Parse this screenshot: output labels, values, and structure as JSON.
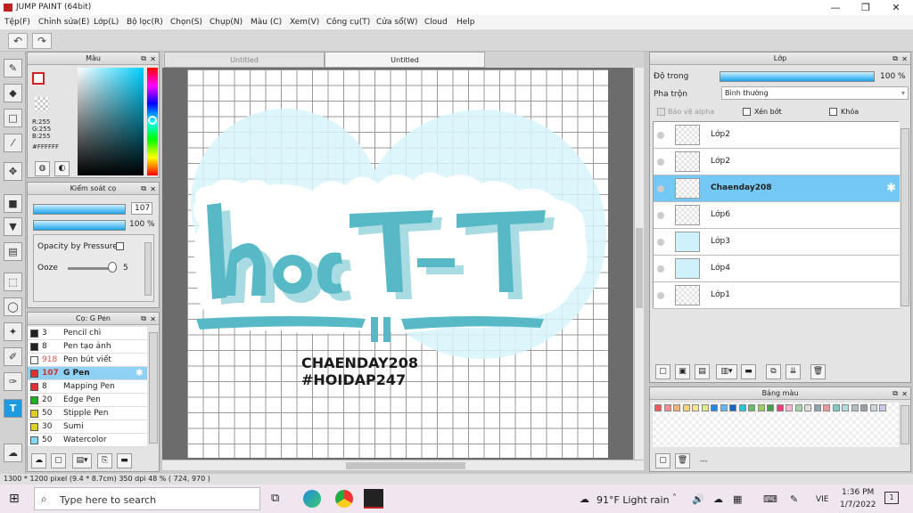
{
  "window": {
    "title": "JUMP PAINT (64bit)"
  },
  "menu": [
    "Tệp(F)",
    "Chỉnh sửa(E)",
    "Lớp(L)",
    "Bộ lọc(R)",
    "Chọn(S)",
    "Chụp(N)",
    "Màu (C)",
    "Xem(V)",
    "Công cụ(T)",
    "Cửa sổ(W)",
    "Cloud",
    "Help"
  ],
  "color_panel": {
    "title": "Màu",
    "r": "R:255",
    "g": "G:255",
    "b": "B:255",
    "hex": "#FFFFFF"
  },
  "brush_control": {
    "title": "Kiểm soát cọ",
    "size": "107",
    "opacity": "100 %",
    "opacity_pressure": "Opacity by Pressure",
    "ooze_label": "Ooze",
    "ooze_value": "5"
  },
  "brush_list": {
    "title": "Cọ: G Pen",
    "items": [
      {
        "size": "3",
        "label": "Pencil chì",
        "color": "#222222"
      },
      {
        "size": "8",
        "label": "Pen tạo ảnh",
        "color": "#222222"
      },
      {
        "size": "918",
        "label": "Pen bút viết",
        "color": "#ffffff"
      },
      {
        "size": "107",
        "label": "G Pen",
        "color": "#e03030",
        "selected": true
      },
      {
        "size": "8",
        "label": "Mapping Pen",
        "color": "#e03030"
      },
      {
        "size": "20",
        "label": "Edge Pen",
        "color": "#20b020"
      },
      {
        "size": "50",
        "label": "Stipple Pen",
        "color": "#e0d020"
      },
      {
        "size": "30",
        "label": "Sumi",
        "color": "#e0d020"
      },
      {
        "size": "50",
        "label": "Watercolor",
        "color": "#7fd8f5"
      }
    ]
  },
  "tabs": [
    "Untitled",
    "Untitled"
  ],
  "artwork": {
    "line1": "CHAENDAY208",
    "line2": "#HOIDAP247"
  },
  "layer_panel": {
    "title": "Lớp",
    "opacity_label": "Độ trong",
    "opacity_value": "100 %",
    "blend_label": "Pha trộn",
    "blend_value": "Bình thường",
    "protect_alpha": "Bảo vệ alpha",
    "clip": "Xén bớt",
    "lock": "Khóa",
    "layers": [
      {
        "name": "Lớp2",
        "selected": false
      },
      {
        "name": "Lớp2",
        "selected": false
      },
      {
        "name": "Chaenday208",
        "selected": true
      },
      {
        "name": "Lớp6",
        "selected": false
      },
      {
        "name": "Lớp3",
        "selected": false
      },
      {
        "name": "Lớp4",
        "selected": false
      },
      {
        "name": "Lớp1",
        "selected": false
      }
    ]
  },
  "palette_panel": {
    "title": "Bảng màu",
    "footer": "---",
    "colors": [
      "#f45a5a",
      "#f98a8a",
      "#f7b07a",
      "#f9d27a",
      "#f6e88a",
      "#d8ee8a",
      "#1e88e5",
      "#64b5f6",
      "#1565c0",
      "#26c6da",
      "#66bb6a",
      "#9ccc65",
      "#43a047",
      "#ec407a",
      "#f8bbd0",
      "#a5d6a7",
      "#e0e0e0",
      "#90a4ae",
      "#ef9a9a",
      "#80cbc4",
      "#b2dfdb",
      "#b0bec5",
      "#9e9e9e",
      "#cfd8dc",
      "#c5cae9"
    ]
  },
  "status": {
    "text": "1300 * 1200 pixel  (9.4 * 8.7cm)  350 dpi  48 %  ( 724, 970 )"
  },
  "taskbar": {
    "search": "Type here to search",
    "weather": "91°F  Light rain",
    "lang": "VIE",
    "time": "1:36 PM",
    "date": "1/7/2022",
    "notif": "1"
  }
}
